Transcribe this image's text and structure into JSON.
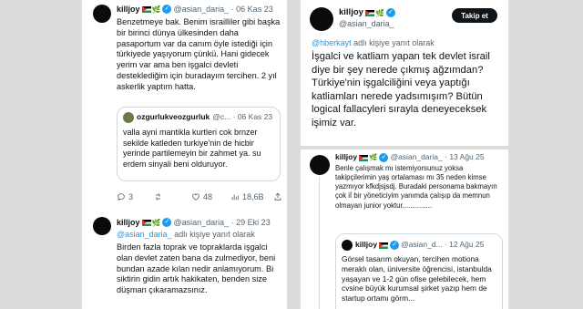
{
  "tweet1": {
    "name": "killjoy",
    "emoji": "🌿",
    "handle": "@asian_daria_",
    "time": "06 Kas 23",
    "text": "Benzetmeye bak. Benim israilliler gibi başka bir birinci dünya ülkesinden daha pasaportum var da canım öyle istediği için türkiyede yaşıyorum çünkü. Hani gidecek yerim var ama ben işgalci devleti desteklediğim için buradayım tercihen. 2 yıl askerlik yaptım hatta.",
    "quote": {
      "name": "ozgurlukveozgurluk",
      "handle": "@c...",
      "time": "06 Kas 23",
      "text": "valla ayni mantikla kurtleri cok brnzer sekilde katleden turkiye'nin de hicbir yerinde partilemeyin bir zahmet ya. su erdem sinyali beni olduruyor."
    },
    "actions": {
      "replies": "3",
      "retweets": "",
      "likes": "48",
      "views": "18,6B"
    }
  },
  "tweet2": {
    "name": "killjoy",
    "emoji": "🌿",
    "handle": "@asian_daria_",
    "time": "29 Eki 23",
    "reply_mention": "@asian_daria_",
    "reply_suffix": "adlı kişiye yanıt olarak",
    "text": "Birden fazla toprak ve topraklarda işgalci olan devlet zaten bana da zulmediyor, beni bundan azade kılan nedir anlamıyorum. Bi siktirin gidin artık hakikaten, benden size düşman çıkaramazsınız."
  },
  "tweet3": {
    "name": "killjoy",
    "emoji": "🌿",
    "handle": "@asian_daria_",
    "follow_label": "Takip et",
    "reply_mention": "@hberkayt",
    "reply_suffix": "adlı kişiye yanıt olarak",
    "text": "İşgalci ve katliam yapan tek devlet israil diye bir şey nerede çıkmış ağzımdan? Türkiye'nin işgalciliğini veya yaptığı katliamları nerede yadsımışım? Bütün logical fallacyleri sırayla deneyeceksek işimiz var."
  },
  "tweet4": {
    "name": "killjoy",
    "emoji": "🌿",
    "handle": "@asian_daria_",
    "time": "13 Ağu 25",
    "text": "Benle çalışmak mı istemiyorsunuz yoksa takipçilerimin yaş ortalaması mı 35 neden kimse yazmıyor kfkdjsjsdj. Buradaki personama bakmayın çok iİ bir yöneticiyim yanımda çalışıp da memnun olmayan junior yoktur...............",
    "quote": {
      "name": "killjoy",
      "handle": "@asian_d...",
      "time": "12 Ağu 25",
      "text": "Görsel tasarım okuyan, tercihen motiona meraklı olan, üniversite öğrencisi, istanbulda yaşayan ve 1-2 gün ofise gelebilecek, hem cvsine büyük kurumsal şirket yazıp hem de startup ortamı görm..."
    }
  }
}
